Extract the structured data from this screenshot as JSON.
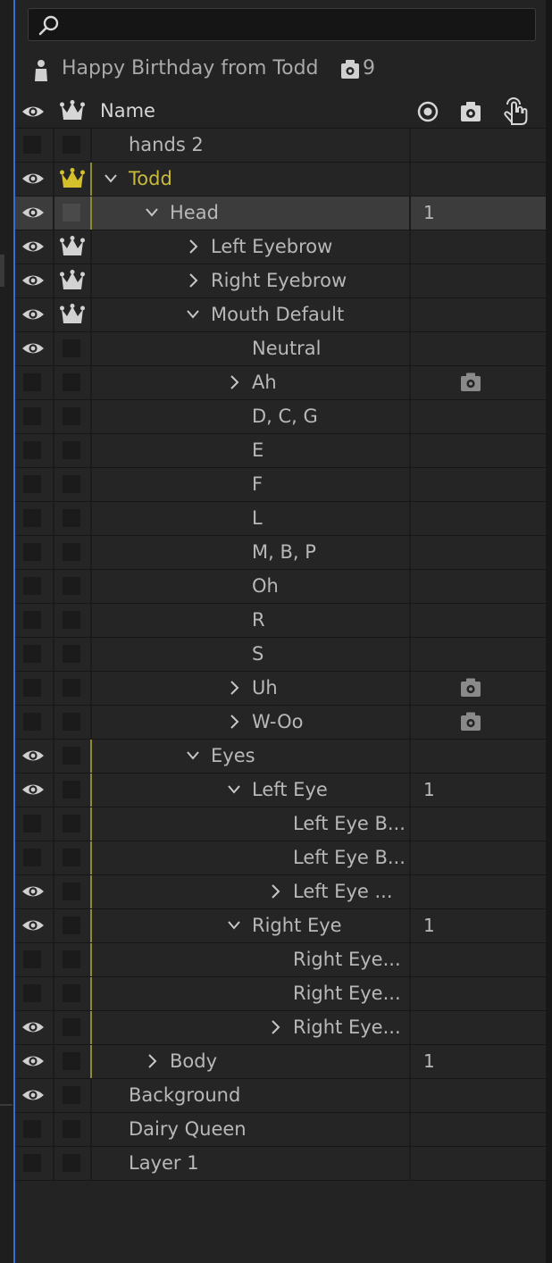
{
  "search": {
    "placeholder": ""
  },
  "composition": {
    "title": "Happy Birthday from Todd",
    "rig_count": "9"
  },
  "header": {
    "name_label": "Name"
  },
  "colors": {
    "accent_blue": "#2f6fd6",
    "todd_yellow": "#c8bb3a",
    "bg": "#232323"
  },
  "rows": [
    {
      "label": "hands 2",
      "indent": 0,
      "twirl": "none",
      "eye": false,
      "crown": "box",
      "bar": false,
      "num": "",
      "rig": false
    },
    {
      "label": "Todd",
      "indent": 0,
      "twirl": "open",
      "eye": true,
      "crown": "yellow",
      "bar": true,
      "num": "",
      "rig": false,
      "highlight": true
    },
    {
      "label": "Head",
      "indent": 1,
      "twirl": "open",
      "eye": true,
      "crown": "box",
      "bar": true,
      "num": "1",
      "rig": false,
      "selected": true
    },
    {
      "label": "Left Eyebrow",
      "indent": 2,
      "twirl": "closed",
      "eye": true,
      "crown": "white",
      "bar": false,
      "num": "",
      "rig": false
    },
    {
      "label": "Right Eyebrow",
      "indent": 2,
      "twirl": "closed",
      "eye": true,
      "crown": "white",
      "bar": false,
      "num": "",
      "rig": false
    },
    {
      "label": "Mouth Default",
      "indent": 2,
      "twirl": "open",
      "eye": true,
      "crown": "white",
      "bar": false,
      "num": "",
      "rig": false
    },
    {
      "label": "Neutral",
      "indent": 3,
      "twirl": "none",
      "eye": true,
      "crown": "box",
      "bar": false,
      "num": "",
      "rig": false
    },
    {
      "label": "Ah",
      "indent": 3,
      "twirl": "closed",
      "eye": false,
      "crown": "box",
      "bar": false,
      "num": "",
      "rig": true
    },
    {
      "label": "D, C, G",
      "indent": 3,
      "twirl": "none",
      "eye": false,
      "crown": "box",
      "bar": false,
      "num": "",
      "rig": false
    },
    {
      "label": "E",
      "indent": 3,
      "twirl": "none",
      "eye": false,
      "crown": "box",
      "bar": false,
      "num": "",
      "rig": false
    },
    {
      "label": "F",
      "indent": 3,
      "twirl": "none",
      "eye": false,
      "crown": "box",
      "bar": false,
      "num": "",
      "rig": false
    },
    {
      "label": "L",
      "indent": 3,
      "twirl": "none",
      "eye": false,
      "crown": "box",
      "bar": false,
      "num": "",
      "rig": false
    },
    {
      "label": "M, B, P",
      "indent": 3,
      "twirl": "none",
      "eye": false,
      "crown": "box",
      "bar": false,
      "num": "",
      "rig": false
    },
    {
      "label": "Oh",
      "indent": 3,
      "twirl": "none",
      "eye": false,
      "crown": "box",
      "bar": false,
      "num": "",
      "rig": false
    },
    {
      "label": "R",
      "indent": 3,
      "twirl": "none",
      "eye": false,
      "crown": "box",
      "bar": false,
      "num": "",
      "rig": false
    },
    {
      "label": "S",
      "indent": 3,
      "twirl": "none",
      "eye": false,
      "crown": "box",
      "bar": false,
      "num": "",
      "rig": false
    },
    {
      "label": "Uh",
      "indent": 3,
      "twirl": "closed",
      "eye": false,
      "crown": "box",
      "bar": false,
      "num": "",
      "rig": true
    },
    {
      "label": "W-Oo",
      "indent": 3,
      "twirl": "closed",
      "eye": false,
      "crown": "box",
      "bar": false,
      "num": "",
      "rig": true
    },
    {
      "label": "Eyes",
      "indent": 2,
      "twirl": "open",
      "eye": true,
      "crown": "box",
      "bar": true,
      "num": "",
      "rig": false
    },
    {
      "label": "Left Eye",
      "indent": 3,
      "twirl": "open",
      "eye": true,
      "crown": "box",
      "bar": true,
      "num": "1",
      "rig": false
    },
    {
      "label": "Left Eye B...",
      "indent": 4,
      "twirl": "none",
      "eye": false,
      "crown": "box",
      "bar": true,
      "num": "",
      "rig": false
    },
    {
      "label": "Left Eye B...",
      "indent": 4,
      "twirl": "none",
      "eye": false,
      "crown": "box",
      "bar": true,
      "num": "",
      "rig": false
    },
    {
      "label": "Left Eye ...",
      "indent": 4,
      "twirl": "closed",
      "eye": true,
      "crown": "box",
      "bar": true,
      "num": "",
      "rig": false
    },
    {
      "label": "Right Eye",
      "indent": 3,
      "twirl": "open",
      "eye": true,
      "crown": "box",
      "bar": true,
      "num": "1",
      "rig": false
    },
    {
      "label": "Right Eye...",
      "indent": 4,
      "twirl": "none",
      "eye": false,
      "crown": "box",
      "bar": true,
      "num": "",
      "rig": false
    },
    {
      "label": "Right Eye...",
      "indent": 4,
      "twirl": "none",
      "eye": false,
      "crown": "box",
      "bar": true,
      "num": "",
      "rig": false
    },
    {
      "label": "Right Eye...",
      "indent": 4,
      "twirl": "closed",
      "eye": true,
      "crown": "box",
      "bar": true,
      "num": "",
      "rig": false
    },
    {
      "label": "Body",
      "indent": 1,
      "twirl": "closed",
      "eye": true,
      "crown": "box",
      "bar": true,
      "num": "1",
      "rig": false
    },
    {
      "label": "Background",
      "indent": 0,
      "twirl": "none",
      "eye": true,
      "crown": "box",
      "bar": false,
      "num": "",
      "rig": false
    },
    {
      "label": "Dairy Queen",
      "indent": 0,
      "twirl": "none",
      "eye": false,
      "crown": "box",
      "bar": false,
      "num": "",
      "rig": false
    },
    {
      "label": "Layer 1",
      "indent": 0,
      "twirl": "none",
      "eye": false,
      "crown": "box",
      "bar": false,
      "num": "",
      "rig": false
    }
  ]
}
